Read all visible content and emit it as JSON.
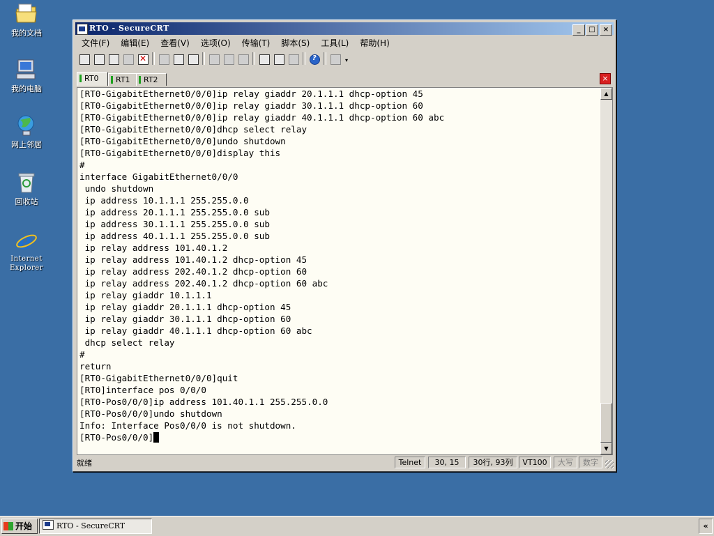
{
  "desktop": {
    "icons": [
      {
        "label": "我的文档"
      },
      {
        "label": "我的电脑"
      },
      {
        "label": "网上邻居"
      },
      {
        "label": "回收站"
      },
      {
        "label": "Internet\nExplorer"
      }
    ]
  },
  "window": {
    "title": "RTO - SecureCRT",
    "buttons": {
      "minimize": "_",
      "maximize": "□",
      "close": "×"
    },
    "menu": [
      "文件(F)",
      "编辑(E)",
      "查看(V)",
      "选项(O)",
      "传输(T)",
      "脚本(S)",
      "工具(L)",
      "帮助(H)"
    ],
    "toolbar_more": "▾",
    "tabs": [
      {
        "label": "RT0",
        "active": true
      },
      {
        "label": "RT1",
        "active": false
      },
      {
        "label": "RT2",
        "active": false
      }
    ],
    "tab_close": "×"
  },
  "terminal": {
    "lines": [
      "[RT0-GigabitEthernet0/0/0]ip relay giaddr 20.1.1.1 dhcp-option 45",
      "[RT0-GigabitEthernet0/0/0]ip relay giaddr 30.1.1.1 dhcp-option 60",
      "[RT0-GigabitEthernet0/0/0]ip relay giaddr 40.1.1.1 dhcp-option 60 abc",
      "[RT0-GigabitEthernet0/0/0]dhcp select relay",
      "[RT0-GigabitEthernet0/0/0]undo shutdown",
      "[RT0-GigabitEthernet0/0/0]display this",
      "#",
      "interface GigabitEthernet0/0/0",
      " undo shutdown",
      " ip address 10.1.1.1 255.255.0.0",
      " ip address 20.1.1.1 255.255.0.0 sub",
      " ip address 30.1.1.1 255.255.0.0 sub",
      " ip address 40.1.1.1 255.255.0.0 sub",
      " ip relay address 101.40.1.2",
      " ip relay address 101.40.1.2 dhcp-option 45",
      " ip relay address 202.40.1.2 dhcp-option 60",
      " ip relay address 202.40.1.2 dhcp-option 60 abc",
      " ip relay giaddr 10.1.1.1",
      " ip relay giaddr 20.1.1.1 dhcp-option 45",
      " ip relay giaddr 30.1.1.1 dhcp-option 60",
      " ip relay giaddr 40.1.1.1 dhcp-option 60 abc",
      " dhcp select relay",
      "#",
      "return",
      "[RT0-GigabitEthernet0/0/0]quit",
      "[RT0]interface pos 0/0/0",
      "[RT0-Pos0/0/0]ip address 101.40.1.1 255.255.0.0",
      "[RT0-Pos0/0/0]undo shutdown",
      "Info: Interface Pos0/0/0 is not shutdown."
    ],
    "prompt": "[RT0-Pos0/0/0]"
  },
  "scrollbar": {
    "up": "▲",
    "down": "▼"
  },
  "status": {
    "ready": "就绪",
    "protocol": "Telnet",
    "cursor_pos": "30,  15",
    "rows_cols": "30行, 93列",
    "emulation": "VT100",
    "caps": "大写",
    "num": "数字"
  },
  "taskbar": {
    "start": "开始",
    "task": "RTO - SecureCRT",
    "tray": "«"
  }
}
